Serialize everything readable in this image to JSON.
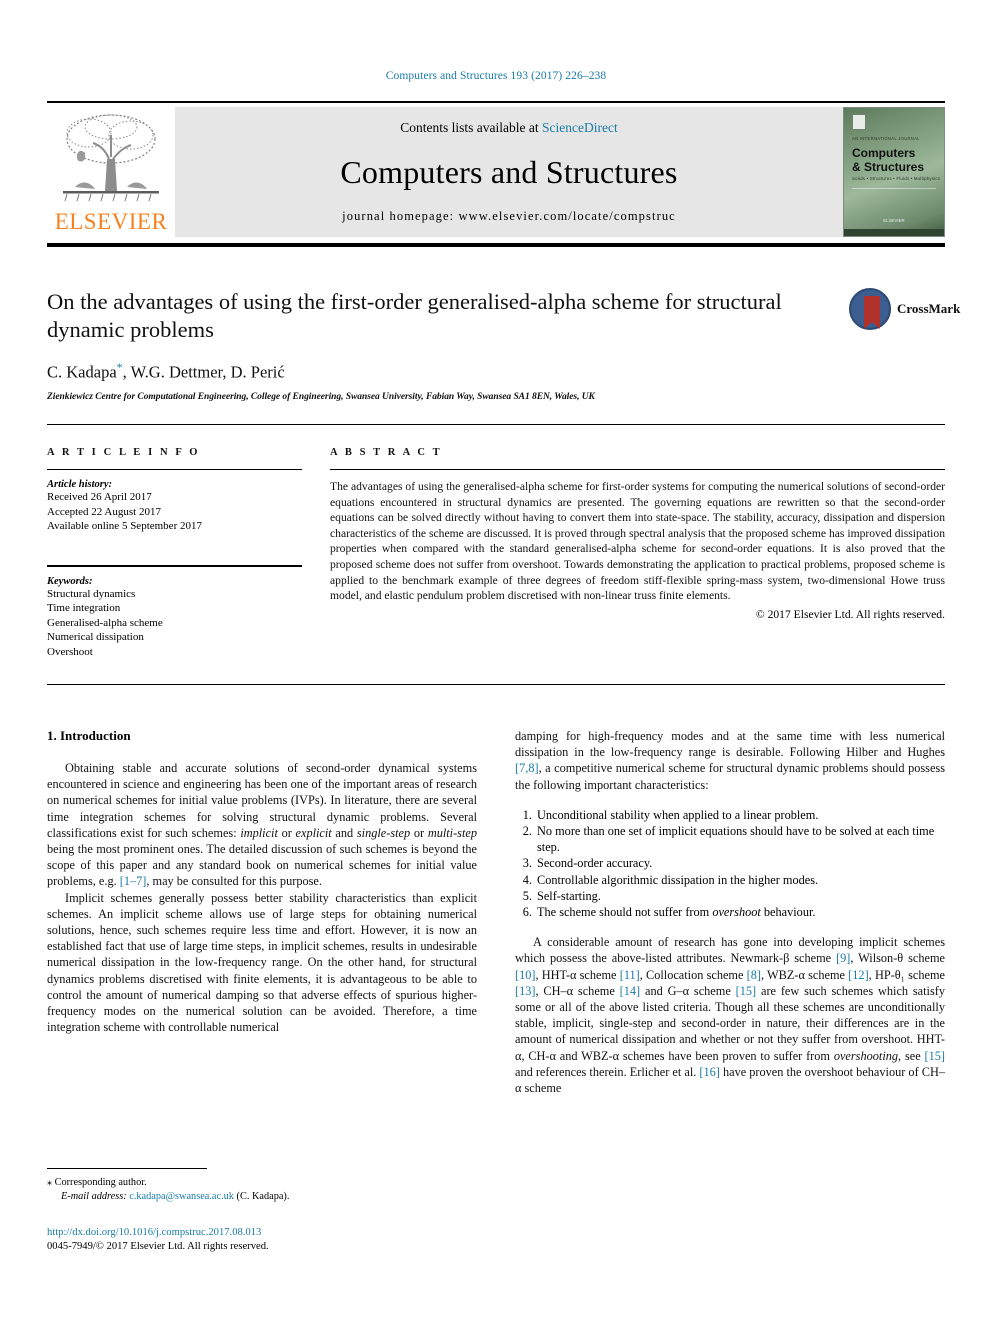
{
  "running_head": "Computers and Structures 193 (2017) 226–238",
  "masthead": {
    "contents_prefix": "Contents lists available at ",
    "sciencedirect": "ScienceDirect",
    "journal_title": "Computers and Structures",
    "homepage": "journal homepage: www.elsevier.com/locate/compstruc",
    "publisher_logo_text": "ELSEVIER",
    "cover": {
      "eyebrow": "AN INTERNATIONAL JOURNAL",
      "title_line1": "Computers",
      "title_line2": "& Structures",
      "subtitle": "Solids • Structures • Fluids • Multiphysics",
      "footer": "ELSEVIER"
    }
  },
  "article": {
    "title": "On the advantages of using the first-order generalised-alpha scheme for structural dynamic problems",
    "crossmark_label": "CrossMark",
    "authors": "C. Kadapa",
    "authors_rest": ", W.G. Dettmer, D. Perić",
    "corresponding_marker": "*",
    "affiliation": "Zienkiewicz Centre for Computational Engineering, College of Engineering, Swansea University, Fabian Way, Swansea SA1 8EN, Wales, UK"
  },
  "info": {
    "heading": "A R T I C L E    I N F O",
    "history_label": "Article history:",
    "history": [
      "Received 26 April 2017",
      "Accepted 22 August 2017",
      "Available online 5 September 2017"
    ],
    "keywords_label": "Keywords:",
    "keywords": [
      "Structural dynamics",
      "Time integration",
      "Generalised-alpha scheme",
      "Numerical dissipation",
      "Overshoot"
    ]
  },
  "abstract": {
    "heading": "A B S T R A C T",
    "text": "The advantages of using the generalised-alpha scheme for first-order systems for computing the numerical solutions of second-order equations encountered in structural dynamics are presented. The governing equations are rewritten so that the second-order equations can be solved directly without having to convert them into state-space. The stability, accuracy, dissipation and dispersion characteristics of the scheme are discussed. It is proved through spectral analysis that the proposed scheme has improved dissipation properties when compared with the standard generalised-alpha scheme for second-order equations. It is also proved that the proposed scheme does not suffer from overshoot. Towards demonstrating the application to practical problems, proposed scheme is applied to the benchmark example of three degrees of freedom stiff-flexible spring-mass system, two-dimensional Howe truss model, and elastic pendulum problem discretised with non-linear truss finite elements.",
    "copyright": "© 2017 Elsevier Ltd. All rights reserved."
  },
  "body": {
    "section_number_title": "1. Introduction",
    "left_p1_a": "Obtaining stable and accurate solutions of second-order dynamical systems encountered in science and engineering has been one of the important areas of research on numerical schemes for initial value problems (IVPs). In literature, there are several time integration schemes for solving structural dynamic problems. Several classifications exist for such schemes: ",
    "left_p1_it1": "implicit",
    "left_p1_b": " or ",
    "left_p1_it2": "explicit",
    "left_p1_c": " and ",
    "left_p1_it3": "single-step",
    "left_p1_d": " or ",
    "left_p1_it4": "multi-step",
    "left_p1_e": " being the most prominent ones. The detailed discussion of such schemes is beyond the scope of this paper and any standard book on numerical schemes for initial value problems, e.g. ",
    "left_p1_ref": "[1–7]",
    "left_p1_f": ", may be consulted for this purpose.",
    "left_p2": "Implicit schemes generally possess better stability characteristics than explicit schemes. An implicit scheme allows use of large steps for obtaining numerical solutions, hence, such schemes require less time and effort. However, it is now an established fact that use of large time steps, in implicit schemes, results in undesirable numerical dissipation in the low-frequency range. On the other hand, for structural dynamics problems discretised with finite elements, it is advantageous to be able to control the amount of numerical damping so that adverse effects of spurious higher-frequency modes on the numerical solution can be avoided. Therefore, a time integration scheme with controllable numerical",
    "right_p1_a": "damping for high-frequency modes and at the same time with less numerical dissipation in the low-frequency range is desirable. Following Hilber and Hughes ",
    "right_p1_ref": "[7,8]",
    "right_p1_b": ", a competitive numerical scheme for structural dynamic problems should possess the following important characteristics:",
    "characteristics": [
      "Unconditional stability when applied to a linear problem.",
      "No more than one set of implicit equations should have to be solved at each time step.",
      "Second-order accuracy.",
      "Controllable algorithmic dissipation in the higher modes.",
      "Self-starting.",
      "The scheme should not suffer from overshoot behaviour."
    ],
    "char6_pre": "The scheme should not suffer from ",
    "char6_it": "overshoot",
    "char6_post": " behaviour.",
    "right_p2_a": "A considerable amount of research has gone into developing implicit schemes which possess the above-listed attributes. Newmark-β scheme ",
    "right_p2_r9": "[9]",
    "right_p2_b": ", Wilson-θ scheme ",
    "right_p2_r10": "[10]",
    "right_p2_c": ", HHT-α scheme ",
    "right_p2_r11": "[11]",
    "right_p2_d": ", Collocation scheme ",
    "right_p2_r8": "[8]",
    "right_p2_e": ", WBZ-α scheme ",
    "right_p2_r12": "[12]",
    "right_p2_f": ", HP-θ₁ scheme ",
    "right_p2_r13": "[13]",
    "right_p2_g": ", CH–α scheme ",
    "right_p2_r14": "[14]",
    "right_p2_h": " and G–α scheme ",
    "right_p2_r15": "[15]",
    "right_p2_i": " are few such schemes which satisfy some or all of the above listed criteria. Though all these schemes are unconditionally stable, implicit, single-step and second-order in nature, their differences are in the amount of numerical dissipation and whether or not they suffer from overshoot. HHT-α, CH-α and WBZ-α schemes have been proven to suffer from ",
    "right_p2_it": "overshooting",
    "right_p2_j": ", see ",
    "right_p2_r15b": "[15]",
    "right_p2_k": " and references therein. Erlicher et al. ",
    "right_p2_r16": "[16]",
    "right_p2_l": " have proven the overshoot behaviour of CH–α scheme"
  },
  "footer": {
    "corresponding_marker": "⁎",
    "corresponding_text": "Corresponding author.",
    "email_label": "E-mail address:",
    "email": "c.kadapa@swansea.ac.uk",
    "email_suffix": "(C. Kadapa).",
    "doi": "http://dx.doi.org/10.1016/j.compstruc.2017.08.013",
    "issn_line": "0045-7949/© 2017 Elsevier Ltd. All rights reserved."
  },
  "colors": {
    "link": "#1a7aa8",
    "elsevier_orange": "#F58220",
    "crossmark_blue": "#3b5d8f",
    "crossmark_red": "#b0322a"
  }
}
